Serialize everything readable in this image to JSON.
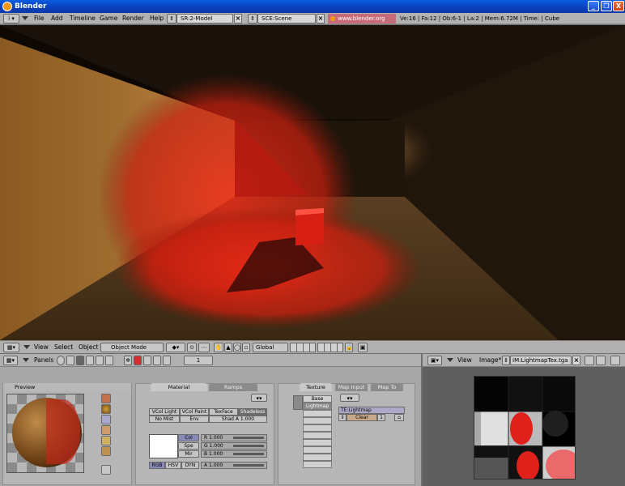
{
  "window": {
    "title": "Blender",
    "buttons": [
      "_",
      "❐",
      "X"
    ]
  },
  "info_header": {
    "menus": [
      "File",
      "Add",
      "Timeline",
      "Game",
      "Render",
      "Help"
    ],
    "screen": "SR:2-Model",
    "scene": "SCE:Scene",
    "url": "www.blender.org 245",
    "stats": "Ve:16 | Fa:12 | Ob:6-1 | La:2  | Mem:6.72M  | Time:  | Cube"
  },
  "view3d_header": {
    "menus": [
      "View",
      "Select",
      "Object"
    ],
    "mode": "Object Mode",
    "orientation": "Global"
  },
  "buttons_window": {
    "label": "Panels",
    "frame": "1",
    "preview_panel": {
      "title": "Preview"
    },
    "material_panel": {
      "tabs": [
        "Material",
        "Ramps"
      ],
      "row1": [
        "VCol Light",
        "VCol Paint",
        "TexFace",
        "Shadeless"
      ],
      "row2": [
        "No Mist",
        "Env",
        "Shad A 1.000"
      ],
      "color_buttons": [
        "Col",
        "Spe",
        "Mir"
      ],
      "sliders": [
        "R 1.000",
        "G 1.000",
        "B 1.000"
      ],
      "modes": [
        "RGB",
        "HSV",
        "DYN"
      ],
      "alpha": "A 1.000"
    },
    "texture_panel": {
      "tabs": [
        "Texture",
        "Map Input",
        "Map To"
      ],
      "channels": [
        "Base",
        "Lightmap"
      ],
      "texture_name": "TE:Lightmap",
      "clear_label": "Clear",
      "users": "1"
    }
  },
  "image_window": {
    "menus": [
      "View",
      "Image*"
    ],
    "image_name": "IM:LightmapTex.tga"
  },
  "colors": {
    "title_bar": "#0b4fcf",
    "url_bg": "#c76b7a",
    "light_red": "#e0201a"
  }
}
